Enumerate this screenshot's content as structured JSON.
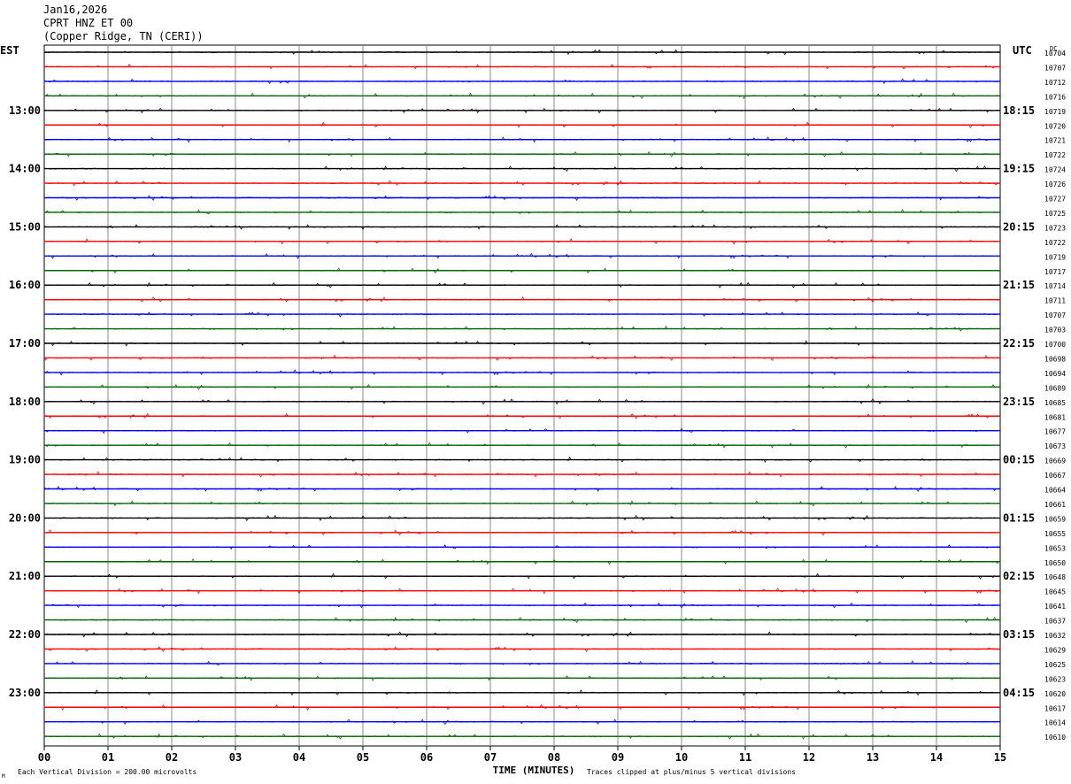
{
  "header": {
    "date": "Jan16,2026",
    "station": "CPRT HNZ ET 00",
    "location": "(Copper Ridge, TN (CERI))"
  },
  "chart_data": {
    "type": "line",
    "left_axis_label": "EST",
    "right_axis_label": "UTC",
    "dc_label": "DC",
    "left_time_labels": [
      "13:00",
      "14:00",
      "15:00",
      "16:00",
      "17:00",
      "18:00",
      "19:00",
      "20:00",
      "21:00",
      "22:00",
      "23:00"
    ],
    "right_time_labels": [
      "18:15",
      "19:15",
      "20:15",
      "21:15",
      "22:15",
      "23:15",
      "00:15",
      "01:15",
      "02:15",
      "03:15",
      "04:15"
    ],
    "time_label_first_row": 4,
    "time_label_every": 4,
    "x_ticks": [
      "00",
      "01",
      "02",
      "03",
      "04",
      "05",
      "06",
      "07",
      "08",
      "09",
      "10",
      "11",
      "12",
      "13",
      "14",
      "15"
    ],
    "xlim": [
      0,
      15
    ],
    "xlabel": "TIME (MINUTES)",
    "trace_colors": [
      "#000000",
      "#ff0000",
      "#0000ff",
      "#006400"
    ],
    "dc_values": [
      10704,
      10707,
      10712,
      10716,
      10719,
      10720,
      10721,
      10722,
      10724,
      10726,
      10727,
      10725,
      10723,
      10722,
      10719,
      10717,
      10714,
      10711,
      10707,
      10703,
      10700,
      10698,
      10694,
      10689,
      10685,
      10681,
      10677,
      10673,
      10669,
      10667,
      10664,
      10661,
      10659,
      10655,
      10653,
      10650,
      10648,
      10645,
      10641,
      10637,
      10632,
      10629,
      10625,
      10623,
      10620,
      10617,
      10614,
      10610
    ],
    "grid": true,
    "scale_note": "Each Vertical Division =  200.00 microvolts",
    "clip_note": "Traces clipped at plus/minus 5 vertical divisions",
    "corner_mark": "M"
  }
}
